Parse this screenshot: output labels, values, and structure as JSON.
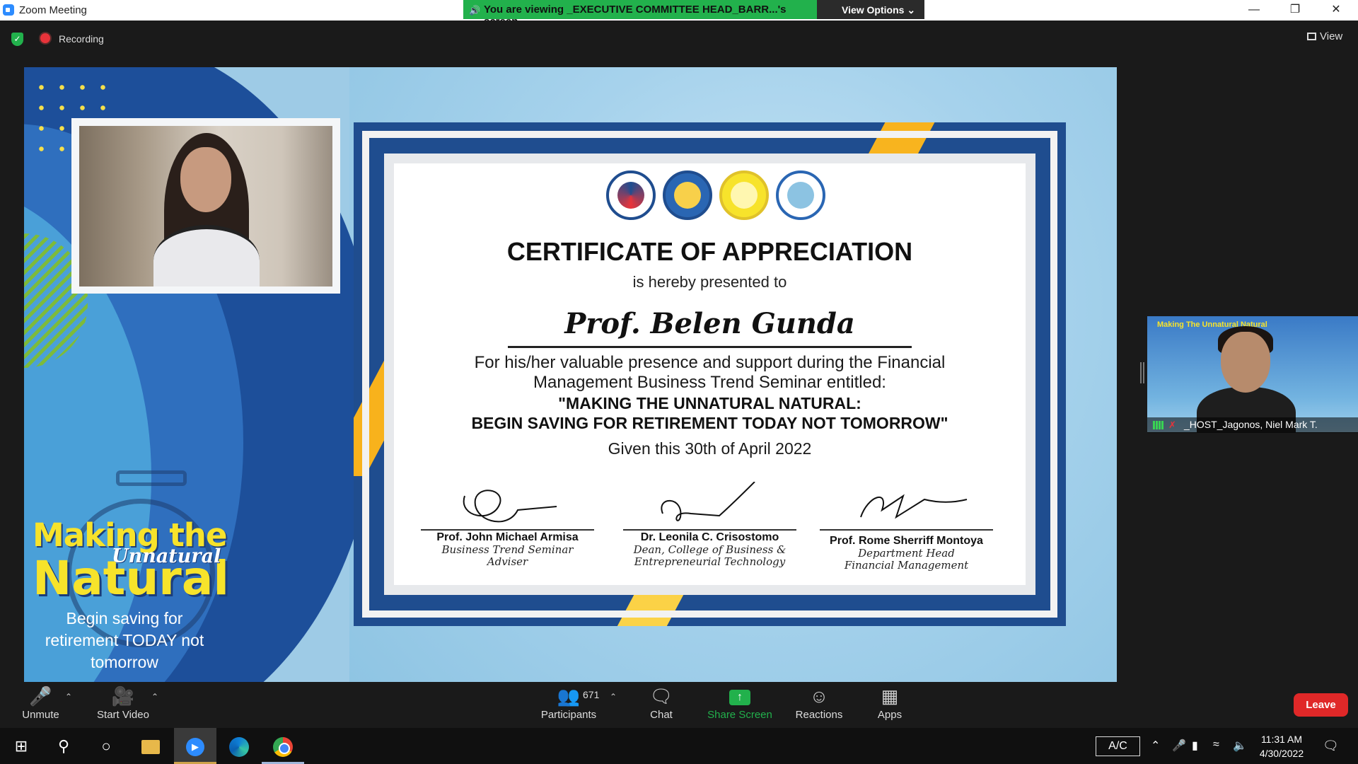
{
  "window": {
    "title": "Zoom Meeting",
    "viewing_banner": "You are viewing _EXECUTIVE COMMITTEE HEAD_BARR...'s screen",
    "view_options": "View Options",
    "minimize_icon": "minimize-icon",
    "restore_icon": "restore-icon",
    "close_icon": "close-icon"
  },
  "header": {
    "recording_label": "Recording",
    "view_label": "View"
  },
  "shared_screen": {
    "logo": {
      "line1": "Making the",
      "line2": "Unnatural",
      "line3": "Natural",
      "tagline": "Begin saving for retirement TODAY not tomorrow"
    },
    "certificate": {
      "title": "CERTIFICATE OF APPRECIATION",
      "presented": "is hereby presented to",
      "name": "Prof. Belen Gunda",
      "body_line1": "For his/her valuable presence and support during the Financial",
      "body_line2": "Management Business Trend Seminar entitled:",
      "seminar_line1": "\"MAKING THE UNNATURAL NATURAL:",
      "seminar_line2": "BEGIN SAVING FOR RETIREMENT TODAY NOT TOMORROW\"",
      "date": "Given this 30th of April 2022",
      "signatories": [
        {
          "name": "Prof. John Michael Armisa",
          "role1": "Business Trend Seminar",
          "role2": "Adviser"
        },
        {
          "name": "Dr. Leonila C. Crisostomo",
          "role1": "Dean, College of Business &",
          "role2": "Entrepreneurial Technology"
        },
        {
          "name": "Prof. Rome Sherriff Montoya",
          "role1": "Department Head",
          "role2": "Financial Management"
        }
      ]
    }
  },
  "host_thumbnail": {
    "name": "_HOST_Jagonos, Niel Mark T.",
    "mini_title": "Making The Unnatural Natural"
  },
  "toolbar": {
    "unmute": "Unmute",
    "start_video": "Start Video",
    "participants": "Participants",
    "participants_count": "671",
    "chat": "Chat",
    "share_screen": "Share Screen",
    "reactions": "Reactions",
    "apps": "Apps",
    "leave": "Leave"
  },
  "taskbar": {
    "ac_label": "A/C",
    "time": "11:31 AM",
    "date": "4/30/2022"
  },
  "colors": {
    "zoom_blue": "#2d8cff",
    "share_green": "#22b14c",
    "leave_red": "#e02828",
    "logo_yellow": "#f7e32b",
    "cert_navy": "#1f4d8f",
    "cert_orange": "#f8b21c"
  }
}
